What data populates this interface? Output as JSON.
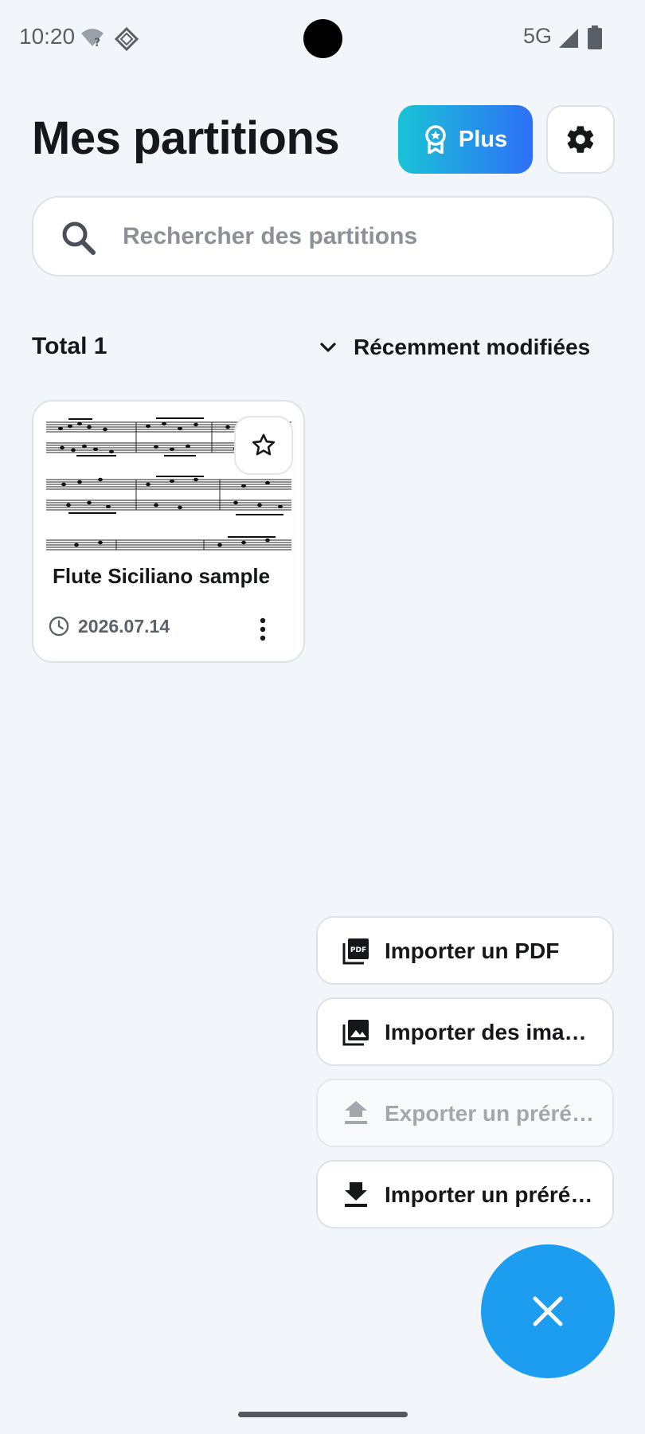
{
  "status_bar": {
    "time": "10:20",
    "network": "5G"
  },
  "header": {
    "title": "Mes partitions",
    "plus_label": "Plus"
  },
  "search": {
    "placeholder": "Rechercher des partitions"
  },
  "list": {
    "total_label": "Total 1",
    "sort_label": "Récemment modifiées"
  },
  "scores": [
    {
      "title": "Flute Siciliano sample",
      "date": "2026.07.14"
    }
  ],
  "fab_menu": {
    "items": [
      {
        "label": "Importer un PDF",
        "icon": "pdf-icon"
      },
      {
        "label": "Importer des ima…",
        "icon": "image-icon"
      },
      {
        "label": "Exporter un préré…",
        "icon": "upload-icon"
      },
      {
        "label": "Importer un préré…",
        "icon": "download-icon"
      }
    ]
  },
  "colors": {
    "accent": "#1c9df0",
    "plus_gradient_start": "#19c3d6",
    "plus_gradient_end": "#2f6ff7",
    "background": "#f2f6fa"
  }
}
